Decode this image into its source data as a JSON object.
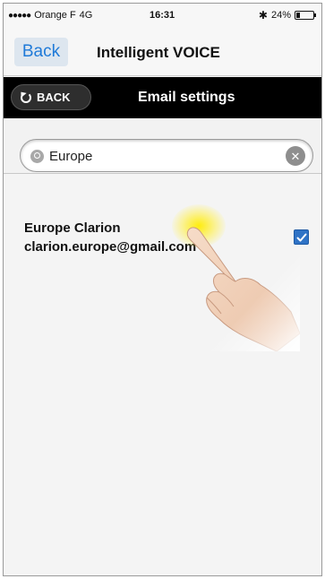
{
  "status_bar": {
    "signal": "●●●●●",
    "carrier": "Orange F",
    "network": "4G",
    "time": "16:31",
    "bluetooth_icon": "bluetooth-icon",
    "battery_percent": "24%",
    "battery_level": 0.24
  },
  "nav": {
    "back_label": "Back",
    "title": "Intelligent VOICE"
  },
  "header": {
    "back_label": "BACK",
    "title": "Email settings"
  },
  "search": {
    "value": "Europe",
    "placeholder": "",
    "clear_icon": "⨂"
  },
  "results": [
    {
      "name": "Europe Clarion",
      "email": "clarion.europe@gmail.com",
      "checked": true
    }
  ],
  "colors": {
    "accent_blue": "#1f7ad8",
    "checkbox_blue": "#2f73c6",
    "header_black": "#000000",
    "highlight_yellow": "#ffec00"
  }
}
